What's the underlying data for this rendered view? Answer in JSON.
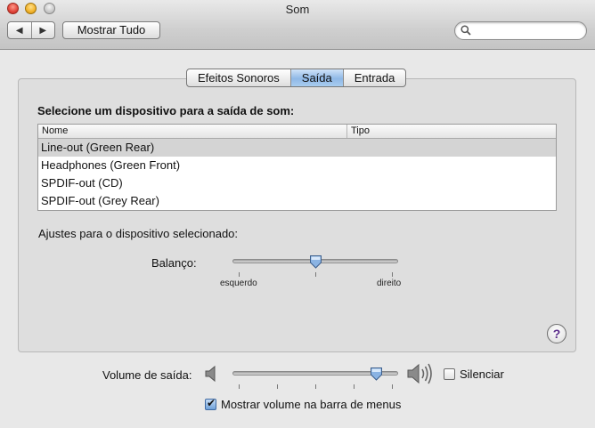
{
  "window": {
    "title": "Som"
  },
  "toolbar": {
    "back": "◀",
    "forward": "▶",
    "show_all": "Mostrar Tudo",
    "search_value": ""
  },
  "tabs": [
    {
      "label": "Efeitos Sonoros",
      "active": false
    },
    {
      "label": "Saída",
      "active": true
    },
    {
      "label": "Entrada",
      "active": false
    }
  ],
  "output": {
    "select_label": "Selecione um dispositivo para a saída de som:",
    "columns": [
      "Nome",
      "Tipo"
    ],
    "devices": [
      {
        "name": "Line-out (Green Rear)",
        "type": "",
        "selected": true
      },
      {
        "name": "Headphones (Green Front)",
        "type": "",
        "selected": false
      },
      {
        "name": "SPDIF-out (CD)",
        "type": "",
        "selected": false
      },
      {
        "name": "SPDIF-out (Grey Rear)",
        "type": "",
        "selected": false
      }
    ],
    "adjust_label": "Ajustes para o dispositivo selecionado:",
    "balance": {
      "label": "Balanço:",
      "left_label": "esquerdo",
      "right_label": "direito",
      "value": 0.5
    }
  },
  "volume": {
    "label": "Volume de saída:",
    "value": 0.9,
    "mute_label": "Silenciar",
    "mute_checked": false,
    "menubar_label": "Mostrar volume na barra de menus",
    "menubar_checked": true
  },
  "help": {
    "label": "?"
  }
}
